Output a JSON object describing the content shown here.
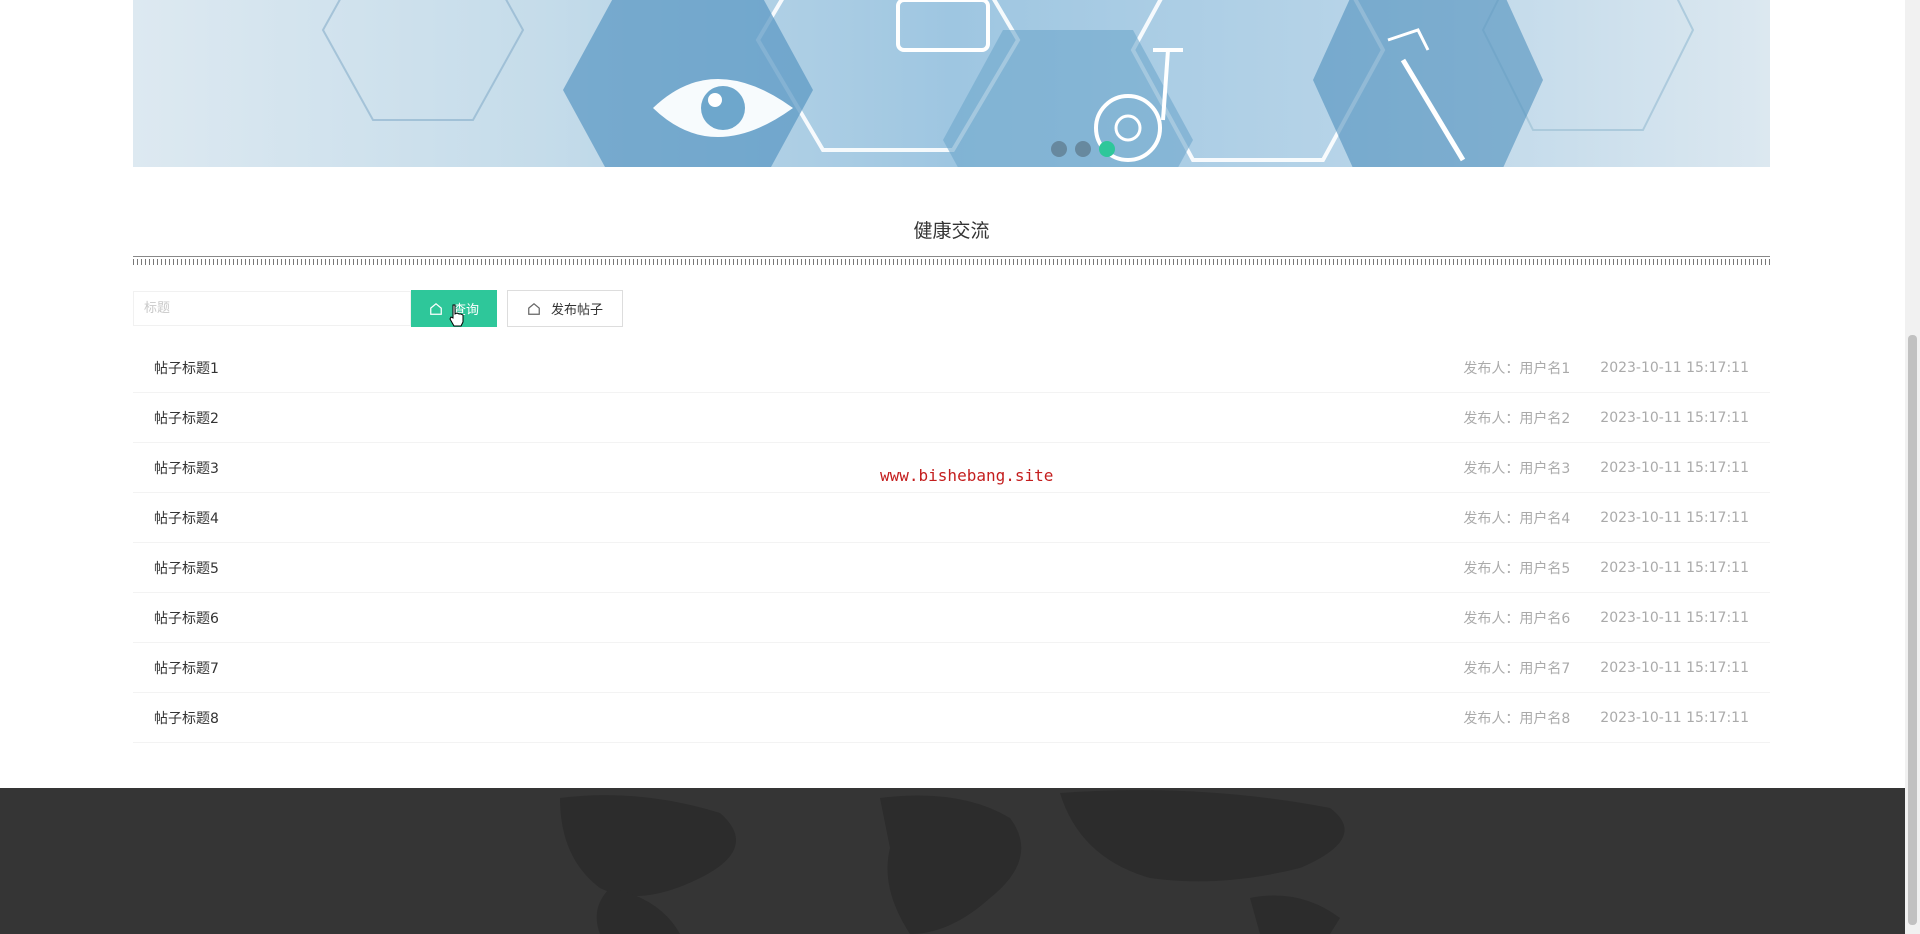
{
  "section": {
    "title": "健康交流"
  },
  "search": {
    "placeholder": "标题",
    "query_label": "查询",
    "post_label": "发布帖子"
  },
  "posts": [
    {
      "title": "帖子标题1",
      "author": "发布人：用户名1",
      "time": "2023-10-11 15:17:11"
    },
    {
      "title": "帖子标题2",
      "author": "发布人：用户名2",
      "time": "2023-10-11 15:17:11"
    },
    {
      "title": "帖子标题3",
      "author": "发布人：用户名3",
      "time": "2023-10-11 15:17:11"
    },
    {
      "title": "帖子标题4",
      "author": "发布人：用户名4",
      "time": "2023-10-11 15:17:11"
    },
    {
      "title": "帖子标题5",
      "author": "发布人：用户名5",
      "time": "2023-10-11 15:17:11"
    },
    {
      "title": "帖子标题6",
      "author": "发布人：用户名6",
      "time": "2023-10-11 15:17:11"
    },
    {
      "title": "帖子标题7",
      "author": "发布人：用户名7",
      "time": "2023-10-11 15:17:11"
    },
    {
      "title": "帖子标题8",
      "author": "发布人：用户名8",
      "time": "2023-10-11 15:17:11"
    }
  ],
  "watermark": "www.bishebang.site",
  "carousel": {
    "slide_count": 3,
    "active_index": 2
  },
  "colors": {
    "accent": "#2ec79a",
    "footer": "#353535",
    "watermark": "#c41e1e"
  },
  "icons": {
    "query": "home-icon",
    "post": "home-icon"
  }
}
